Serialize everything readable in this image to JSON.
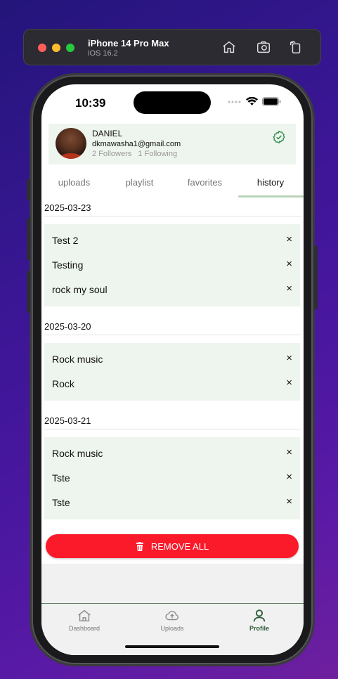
{
  "simulator": {
    "device": "iPhone 14 Pro Max",
    "os": "iOS 16.2"
  },
  "status_bar": {
    "time": "10:39"
  },
  "profile": {
    "name": "DANIEL",
    "email": "dkmawasha1@gmail.com",
    "followers": "2 Followers",
    "following": "1 Following"
  },
  "tabs": [
    {
      "label": "uploads"
    },
    {
      "label": "playlist"
    },
    {
      "label": "favorites"
    },
    {
      "label": "history"
    }
  ],
  "history": [
    {
      "date": "2025-03-23",
      "items": [
        {
          "title": "Test 2"
        },
        {
          "title": "Testing"
        },
        {
          "title": "rock my soul"
        }
      ]
    },
    {
      "date": "2025-03-20",
      "items": [
        {
          "title": "Rock music"
        },
        {
          "title": "Rock"
        }
      ]
    },
    {
      "date": "2025-03-21",
      "items": [
        {
          "title": "Rock music"
        },
        {
          "title": "Tste"
        },
        {
          "title": "Tste"
        }
      ]
    }
  ],
  "close_glyph": "×",
  "remove_all_label": "REMOVE ALL",
  "bottom_nav": [
    {
      "label": "Dashboard"
    },
    {
      "label": "Uploads"
    },
    {
      "label": "Profile"
    }
  ],
  "colors": {
    "accent": "#2f5e3a",
    "danger": "#fb1a2a",
    "card": "#eef4ee"
  }
}
